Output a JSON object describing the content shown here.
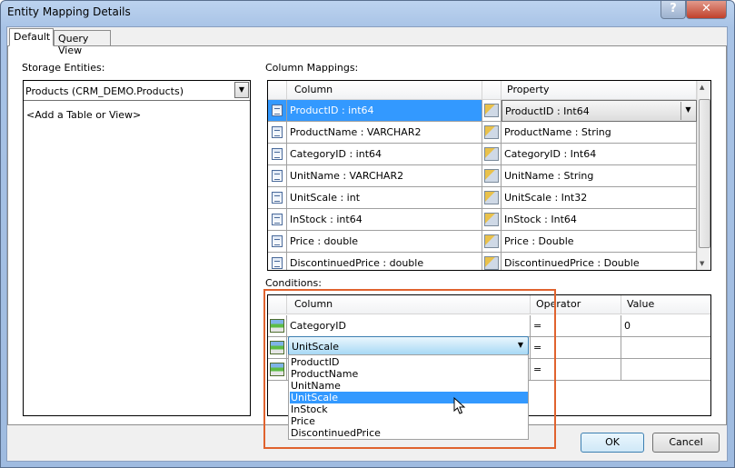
{
  "window": {
    "title": "Entity Mapping Details",
    "help_icon": "question-icon",
    "close_icon": "close-icon"
  },
  "tabs": [
    {
      "label": "Default",
      "active": true
    },
    {
      "label": "Query View",
      "active": false
    }
  ],
  "storage": {
    "label": "Storage Entities:",
    "selected": "Products (CRM_DEMO.Products)",
    "add_placeholder": "<Add a Table or View>"
  },
  "column_mappings": {
    "label": "Column Mappings:",
    "headers": {
      "column": "Column",
      "property": "Property"
    },
    "rows": [
      {
        "column": "ProductID : int64",
        "property": "ProductID : Int64",
        "selected": true
      },
      {
        "column": "ProductName : VARCHAR2",
        "property": "ProductName : String"
      },
      {
        "column": "CategoryID : int64",
        "property": "CategoryID : Int64"
      },
      {
        "column": "UnitName : VARCHAR2",
        "property": "UnitName : String"
      },
      {
        "column": "UnitScale : int",
        "property": "UnitScale : Int32"
      },
      {
        "column": "InStock : int64",
        "property": "InStock : Int64"
      },
      {
        "column": "Price : double",
        "property": "Price : Double"
      },
      {
        "column": "DiscontinuedPrice : double",
        "property": "DiscontinuedPrice : Double"
      }
    ]
  },
  "conditions": {
    "label": "Conditions:",
    "headers": {
      "column": "Column",
      "operator": "Operator",
      "value": "Value"
    },
    "rows": [
      {
        "column": "CategoryID",
        "operator": "=",
        "value": "0"
      },
      {
        "column": "UnitScale",
        "operator": "=",
        "value": ""
      },
      {
        "column": "",
        "operator": "=",
        "value": ""
      }
    ],
    "dropdown_options": [
      "ProductID",
      "ProductName",
      "UnitName",
      "UnitScale",
      "InStock",
      "Price",
      "DiscontinuedPrice"
    ],
    "dropdown_highlighted": "UnitScale"
  },
  "buttons": {
    "ok": "OK",
    "cancel": "Cancel"
  },
  "colors": {
    "selection": "#3399ff",
    "highlight_box": "#e0622e"
  }
}
